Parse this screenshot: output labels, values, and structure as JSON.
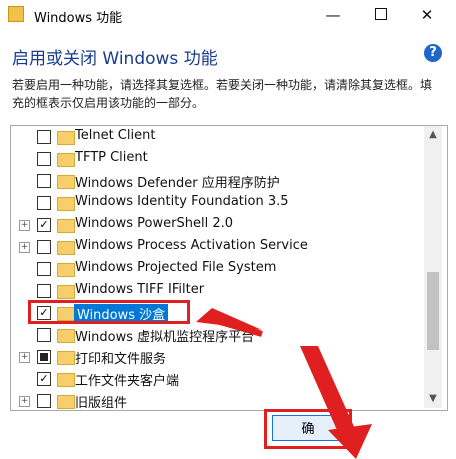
{
  "window": {
    "title": "Windows 功能",
    "minimize": "—",
    "close": "✕"
  },
  "heading": "启用或关闭 Windows 功能",
  "description": "若要启用一种功能，请选择其复选框。若要关闭一种功能，请清除其复选框。填充的框表示仅启用该功能的一部分。",
  "features": [
    {
      "label": "Telnet Client",
      "checked": false,
      "expandable": false
    },
    {
      "label": "TFTP Client",
      "checked": false,
      "expandable": false
    },
    {
      "label": "Windows Defender 应用程序防护",
      "checked": false,
      "expandable": false
    },
    {
      "label": "Windows Identity Foundation 3.5",
      "checked": false,
      "expandable": false
    },
    {
      "label": "Windows PowerShell 2.0",
      "checked": true,
      "expandable": true
    },
    {
      "label": "Windows Process Activation Service",
      "checked": false,
      "expandable": true
    },
    {
      "label": "Windows Projected File System",
      "checked": false,
      "expandable": false
    },
    {
      "label": "Windows TIFF IFilter",
      "checked": false,
      "expandable": false
    },
    {
      "label": "Windows 沙盒",
      "checked": true,
      "expandable": false,
      "selected": true
    },
    {
      "label": "Windows 虚拟机监控程序平台",
      "checked": false,
      "expandable": false
    },
    {
      "label": "打印和文件服务",
      "checked": "partial",
      "expandable": true
    },
    {
      "label": "工作文件夹客户端",
      "checked": true,
      "expandable": false
    },
    {
      "label": "旧版组件",
      "checked": false,
      "expandable": true
    }
  ],
  "ok_button": "确"
}
